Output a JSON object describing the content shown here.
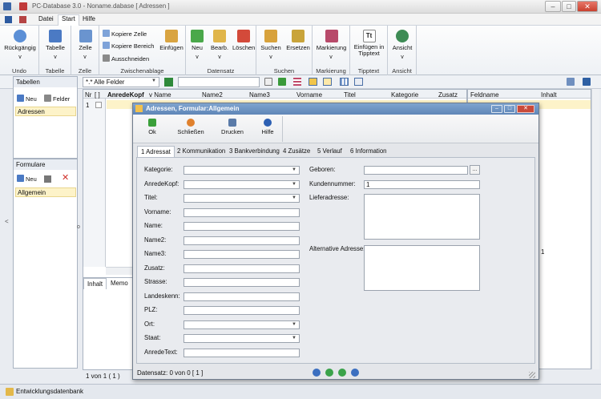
{
  "window": {
    "title": "PC-Database 3.0 - Noname.dabase [ Adressen ]"
  },
  "menu": {
    "items": [
      "Datei",
      "Start",
      "Hilfe"
    ]
  },
  "ribbon": {
    "undo": {
      "label": "Rückgängig",
      "group": "Undo"
    },
    "tabelle": {
      "label": "Tabelle",
      "group": "Tabelle"
    },
    "zelle": {
      "label": "Zelle",
      "group": "Zelle"
    },
    "zwischenablage": {
      "kopiere_zelle": "Kopiere Zelle",
      "kopiere_bereich": "Kopiere Bereich",
      "ausschneiden": "Ausschneiden",
      "einfuegen": "Einfügen",
      "group": "Zwischenablage"
    },
    "datensatz": {
      "neu": "Neu",
      "bearb": "Bearb.",
      "loeschen": "Löschen",
      "group": "Datensatz"
    },
    "suchen": {
      "suchen": "Suchen",
      "ersetzen": "Ersetzen",
      "group": "Suchen"
    },
    "markierung": {
      "label": "Markierung",
      "group": "Markierung"
    },
    "tipptext": {
      "label": "Einfügen in Tipptext",
      "group": "Tipptext"
    },
    "ansicht": {
      "label": "Ansicht",
      "group": "Ansicht"
    },
    "arrow": "v"
  },
  "toolbar": {
    "field_filter": "*.* Alle Felder",
    "search_value": ""
  },
  "tables_panel": {
    "title": "Tabellen",
    "neu": "Neu",
    "felder": "Felder",
    "items": [
      "Adressen"
    ]
  },
  "forms_panel": {
    "title": "Formulare",
    "neu": "Neu",
    "items": [
      "Allgemein"
    ]
  },
  "grid": {
    "nr_header": "Nr",
    "check_header": "[ ]",
    "row_nr": "1",
    "columns": [
      "AnredeKopf",
      "Name",
      "Name2",
      "Name3",
      "Vorname",
      "Titel",
      "Kategorie",
      "Zusatz"
    ],
    "footer": "1 von 1 ( 1 )",
    "bottom_tabs": [
      "Inhalt",
      "Memo"
    ]
  },
  "right_panel": {
    "headers": [
      "Feldname",
      "Inhalt"
    ],
    "value_row": "1"
  },
  "collapse_left": "<",
  "collapse_mid": "o",
  "dialog": {
    "title": "Adressen, Formular:Allgemein",
    "buttons": {
      "ok": "Ok",
      "schliessen": "Schließen",
      "drucken": "Drucken",
      "hilfe": "Hilfe"
    },
    "tabs": [
      "1 Adressat",
      "2 Kommunikation",
      "3 Bankverbindung",
      "4 Zusätze",
      "5 Verlauf",
      "6 Information"
    ],
    "left_fields": [
      {
        "label": "Kategorie:",
        "value": ""
      },
      {
        "label": "AnredeKopf:",
        "value": ""
      },
      {
        "label": "Titel:",
        "value": ""
      },
      {
        "label": "Vorname:",
        "value": ""
      },
      {
        "label": "Name:",
        "value": ""
      },
      {
        "label": "Name2:",
        "value": ""
      },
      {
        "label": "Name3:",
        "value": ""
      },
      {
        "label": "Zusatz:",
        "value": ""
      },
      {
        "label": "Strasse:",
        "value": ""
      },
      {
        "label": "Landeskenn:",
        "value": ""
      },
      {
        "label": "PLZ:",
        "value": ""
      },
      {
        "label": "Ort:",
        "value": ""
      },
      {
        "label": "Staat:",
        "value": ""
      },
      {
        "label": "AnredeText:",
        "value": ""
      }
    ],
    "geboren_label": "Geboren:",
    "geboren_value": "",
    "date_button": "...",
    "kundennummer_label": "Kundennummer:",
    "kundennummer_value": "1",
    "lieferadresse_label": "Lieferadresse:",
    "alt_adresse_label": "Alternative Adresse:",
    "status": "Datensatz: 0 von 0 [ 1 ]"
  },
  "statusbar": {
    "text": "Entwicklungsdatenbank"
  },
  "colors": {
    "accent": "#5f86b8",
    "selection": "#fdf3c9"
  }
}
